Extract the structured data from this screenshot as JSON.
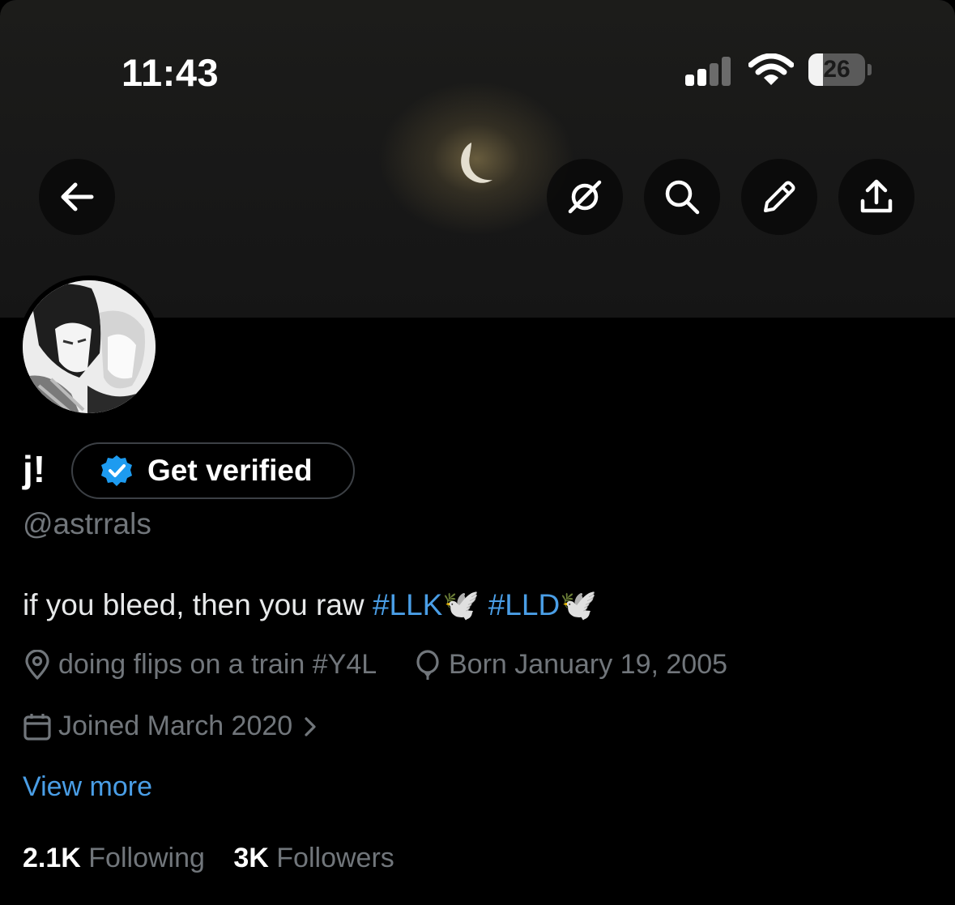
{
  "status_bar": {
    "time": "11:43",
    "battery_level": "26",
    "battery_fraction": 0.26
  },
  "profile": {
    "display_name": "j!",
    "verify_label": "Get verified",
    "handle": "@astrrals",
    "bio_text": "if you bleed, then you raw ",
    "bio_tag1": "#LLK",
    "bio_emoji1": "🕊️",
    "bio_tag2": "#LLD",
    "bio_emoji2": "🕊️",
    "location": "doing flips on a train #Y4L",
    "birthday": "Born January 19, 2005",
    "joined": "Joined March 2020",
    "view_more": "View more",
    "following_count": "2.1K",
    "following_label": "Following",
    "followers_count": "3K",
    "followers_label": "Followers"
  },
  "icons": {
    "back": "arrow-left-icon",
    "grok": "grok-icon",
    "search": "search-icon",
    "edit": "pencil-icon",
    "share": "share-icon",
    "verified": "verified-badge-icon",
    "location": "location-pin-icon",
    "birthday": "balloon-icon",
    "joined": "calendar-icon",
    "chevron": "chevron-right-icon"
  },
  "colors": {
    "accent": "#4a9ee6",
    "muted": "#71767b",
    "background": "#000000"
  }
}
